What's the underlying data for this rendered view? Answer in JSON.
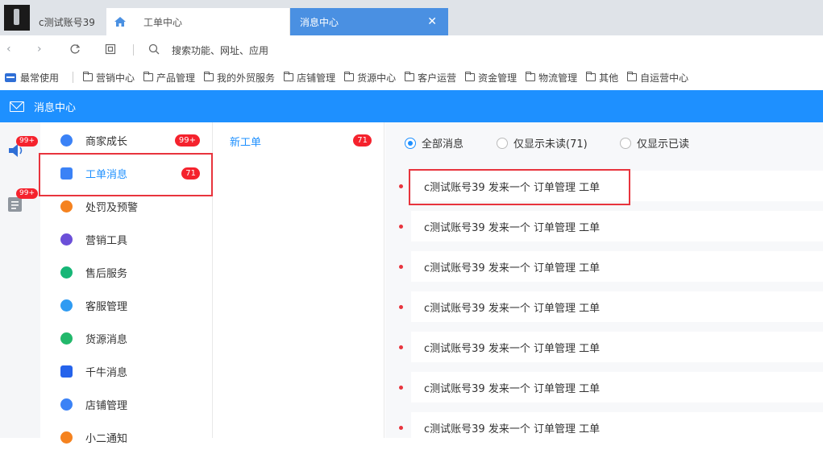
{
  "browser": {
    "tabs": {
      "account": "c测试账号39",
      "workorder": "工单中心",
      "message": "消息中心"
    },
    "search_placeholder": "搜索功能、网址、应用",
    "bookmarks": {
      "frequent": "最常使用",
      "folders": [
        "营销中心",
        "产品管理",
        "我的外贸服务",
        "店铺管理",
        "货源中心",
        "客户运营",
        "资金管理",
        "物流管理",
        "其他",
        "自运营中心"
      ]
    }
  },
  "header": {
    "title": "消息中心"
  },
  "rail": {
    "badges": [
      "99+",
      "99+"
    ]
  },
  "categories": [
    {
      "label": "商家成长",
      "badge": "99+",
      "icon": "growth-icon",
      "color": "#3b82f6"
    },
    {
      "label": "工单消息",
      "badge": "71",
      "icon": "ticket-icon",
      "color": "#3b82f6"
    },
    {
      "label": "处罚及预警",
      "badge": "",
      "icon": "warning-icon",
      "color": "#f5821f"
    },
    {
      "label": "营销工具",
      "badge": "",
      "icon": "marketing-icon",
      "color": "#6b4fd8"
    },
    {
      "label": "售后服务",
      "badge": "",
      "icon": "aftersale-icon",
      "color": "#16b676"
    },
    {
      "label": "客服管理",
      "badge": "",
      "icon": "customer-service-icon",
      "color": "#2f9bf2"
    },
    {
      "label": "货源消息",
      "badge": "",
      "icon": "supply-icon",
      "color": "#22b86b"
    },
    {
      "label": "千牛消息",
      "badge": "",
      "icon": "qianniu-icon",
      "color": "#2563eb"
    },
    {
      "label": "店铺管理",
      "badge": "",
      "icon": "store-icon",
      "color": "#3b82f6"
    },
    {
      "label": "小二通知",
      "badge": "",
      "icon": "notice-icon",
      "color": "#f5821f"
    }
  ],
  "subcategory": {
    "label": "新工单",
    "badge": "71"
  },
  "filters": {
    "all": "全部消息",
    "unread": "仅显示未读(71)",
    "read": "仅显示已读"
  },
  "messages": [
    "c测试账号39 发来一个 订单管理 工单",
    "c测试账号39 发来一个 订单管理 工单",
    "c测试账号39 发来一个 订单管理 工单",
    "c测试账号39 发来一个 订单管理 工单",
    "c测试账号39 发来一个 订单管理 工单",
    "c测试账号39 发来一个 订单管理 工单",
    "c测试账号39 发来一个 订单管理 工单"
  ],
  "colors": {
    "accent": "#1e90ff",
    "badge": "#f5222d",
    "highlight": "#e8343d"
  }
}
